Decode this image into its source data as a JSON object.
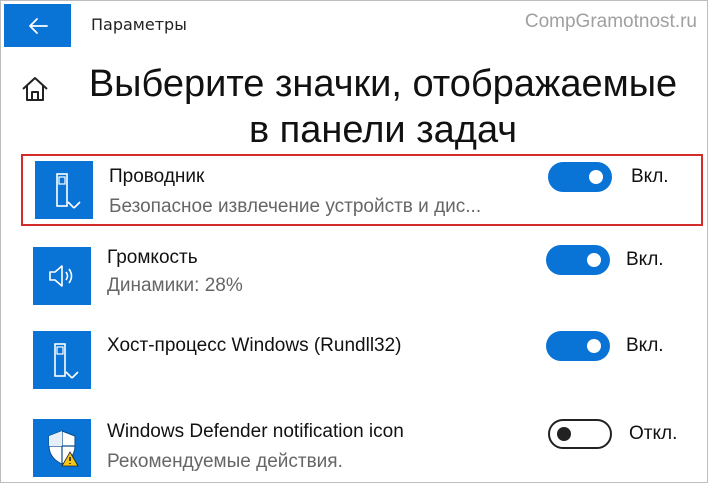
{
  "window": {
    "title": "Параметры"
  },
  "watermark": "CompGramotnost.ru",
  "page": {
    "title_line1": "Выберите значки, отображаемые",
    "title_line2": "в панели задач"
  },
  "items": [
    {
      "name": "Проводник",
      "description": "Безопасное извлечение устройств и дис...",
      "state": "Вкл.",
      "on": true,
      "icon": "usb-drive-icon"
    },
    {
      "name": "Громкость",
      "description": "Динамики: 28%",
      "state": "Вкл.",
      "on": true,
      "icon": "speaker-icon"
    },
    {
      "name": "Хост-процесс Windows (Rundll32)",
      "description": "",
      "state": "Вкл.",
      "on": true,
      "icon": "usb-drive-icon"
    },
    {
      "name": "Windows Defender notification icon",
      "description": "Рекомендуемые действия.",
      "state": "Откл.",
      "on": false,
      "icon": "defender-shield-warning-icon"
    }
  ],
  "colors": {
    "accent": "#0a74d6",
    "highlight_border": "#d52b2b"
  }
}
